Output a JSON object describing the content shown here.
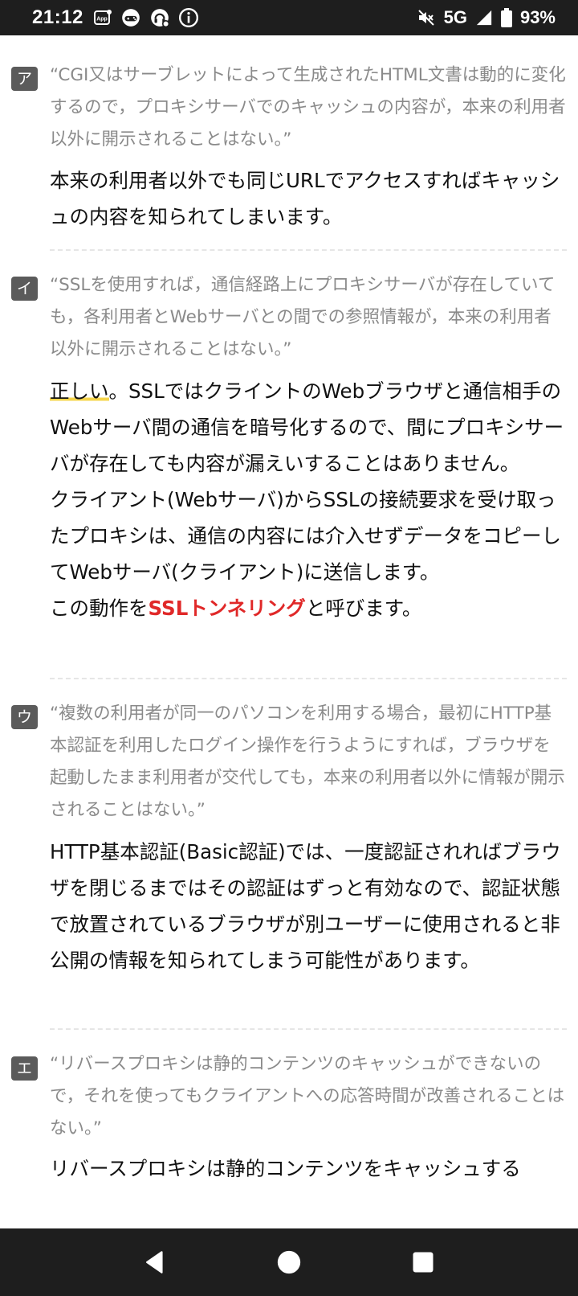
{
  "status_bar": {
    "time": "21:12",
    "left_icons": [
      "app-notification-icon",
      "gamepad-icon",
      "headset-icon",
      "info-icon"
    ],
    "network": "5G",
    "battery": "93%",
    "right_icons": [
      "mute-icon",
      "signal-icon",
      "battery-icon"
    ]
  },
  "items": [
    {
      "label": "ア",
      "quote": "“CGI又はサーブレットによって生成されたHTML文書は動的に変化するので，プロキシサーバでのキャッシュの内容が，本来の利用者以外に開示されることはない。”",
      "answer": "本来の利用者以外でも同じURLでアクセスすればキャッシュの内容を知られてしまいます。"
    },
    {
      "label": "イ",
      "quote": "“SSLを使用すれば，通信経路上にプロキシサーバが存在していても，各利用者とWebサーバとの間での参照情報が，本来の利用者以外に開示されることはない。”",
      "answer_highlight": "正しい",
      "answer_part1": "。SSLではクライントのWebブラウザと通信相手のWebサーバ間の通信を暗号化するので、間にプロキシサーバが存在しても内容が漏えいすることはありません。",
      "answer_part2": "クライアント(Webサーバ)からSSLの接続要求を受け取ったプロキシは、通信の内容には介入せずデータをコピーしてWebサーバ(クライアント)に送信します。",
      "answer_part3_pre": "この動作を",
      "answer_part3_term": "SSLトンネリング",
      "answer_part3_post": "と呼びます。"
    },
    {
      "label": "ウ",
      "quote": "“複数の利用者が同一のパソコンを利用する場合，最初にHTTP基本認証を利用したログイン操作を行うようにすれば，ブラウザを起動したまま利用者が交代しても，本来の利用者以外に情報が開示されることはない。”",
      "answer": "HTTP基本認証(Basic認証)では、一度認証されればブラウザを閉じるまではその認証はずっと有効なので、認証状態で放置されているブラウザが別ユーザーに使用されると非公開の情報を知られてしまう可能性があります。"
    },
    {
      "label": "エ",
      "quote": "“リバースプロキシは静的コンテンツのキャッシュができないので，それを使ってもクライアントへの応答時間が改善されることはない。”",
      "answer": "リバースプロキシは静的コンテンツをキャッシュする"
    }
  ],
  "nav_bar": {
    "buttons": [
      "back-icon",
      "home-icon",
      "recents-icon"
    ]
  }
}
